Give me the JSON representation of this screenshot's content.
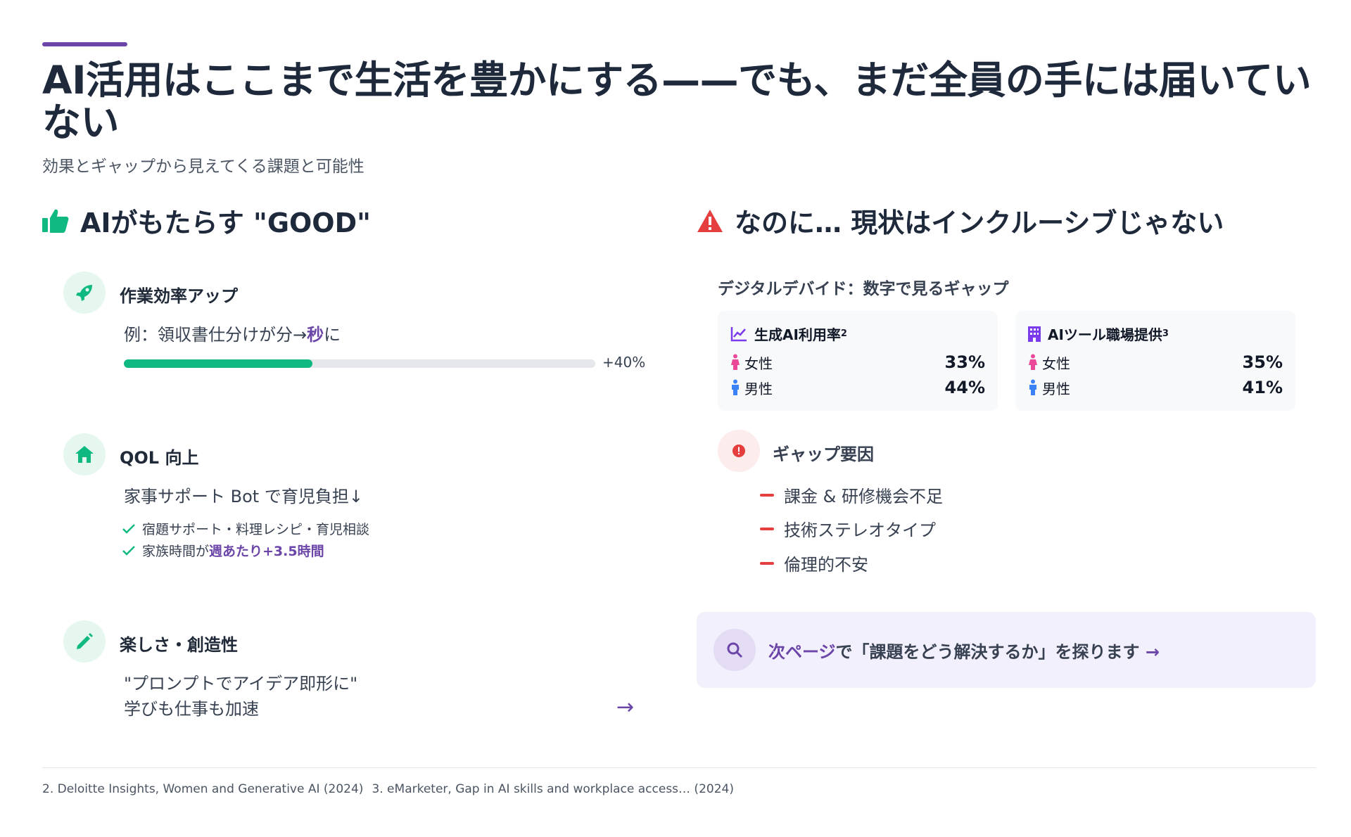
{
  "header": {
    "title": "AI活用はここまで生活を豊かにする——でも、まだ全員の手には届いていない",
    "subtitle": "効果とギャップから見えてくる課題と可能性"
  },
  "good": {
    "heading": "AIがもたらす \"GOOD\"",
    "icon": "thumbs-up-icon",
    "efficiency": {
      "title": "作業効率アップ",
      "example_prefix": "例：領収書仕分けが分→",
      "example_highlight": "秒",
      "example_suffix": "に",
      "progress": 0.4,
      "progress_label": "+40%"
    },
    "qol": {
      "title": "QOL 向上",
      "text": "家事サポート Bot で育児負担↓",
      "checks": [
        "宿題サポート・料理レシピ・育児相談",
        "家族時間が "
      ],
      "check2_highlight": "週あたり+3.5時間"
    },
    "creativity": {
      "title": "楽しさ・創造性",
      "line1": "\"プロンプトでアイデア即形に\"",
      "line2": "学びも仕事も加速",
      "arrow": "→"
    }
  },
  "gap": {
    "heading": "なのに… 現状はインクルーシブじゃない",
    "label": "デジタルデバイド：数字で見るギャップ",
    "cards": [
      {
        "title": "生成AI利用率",
        "sup": "2",
        "icon": "line-chart-icon",
        "rows": [
          {
            "label": "女性",
            "value": "33%"
          },
          {
            "label": "男性",
            "value": "44%"
          }
        ]
      },
      {
        "title": "AIツール職場提供",
        "sup": "3",
        "icon": "building-icon",
        "rows": [
          {
            "label": "女性",
            "value": "35%"
          },
          {
            "label": "男性",
            "value": "41%"
          }
        ]
      }
    ],
    "factors_title": "ギャップ要因",
    "factors": [
      "課金 & 研修機会不足",
      "技術ステレオタイプ",
      "倫理的不安"
    ]
  },
  "next": {
    "link": "次ページ",
    "text": "で「課題をどう解決するか」を探ります",
    "arrow": "→"
  },
  "footnotes": [
    "2. Deloitte Insights, Women and Generative AI (2024)",
    "3. eMarketer, Gap in AI skills and workplace access… (2024)"
  ],
  "colors": {
    "accent": "#6b46a8",
    "green": "#10b981",
    "red": "#e53e3e",
    "female": "#ec4899",
    "male": "#3b82f6"
  }
}
